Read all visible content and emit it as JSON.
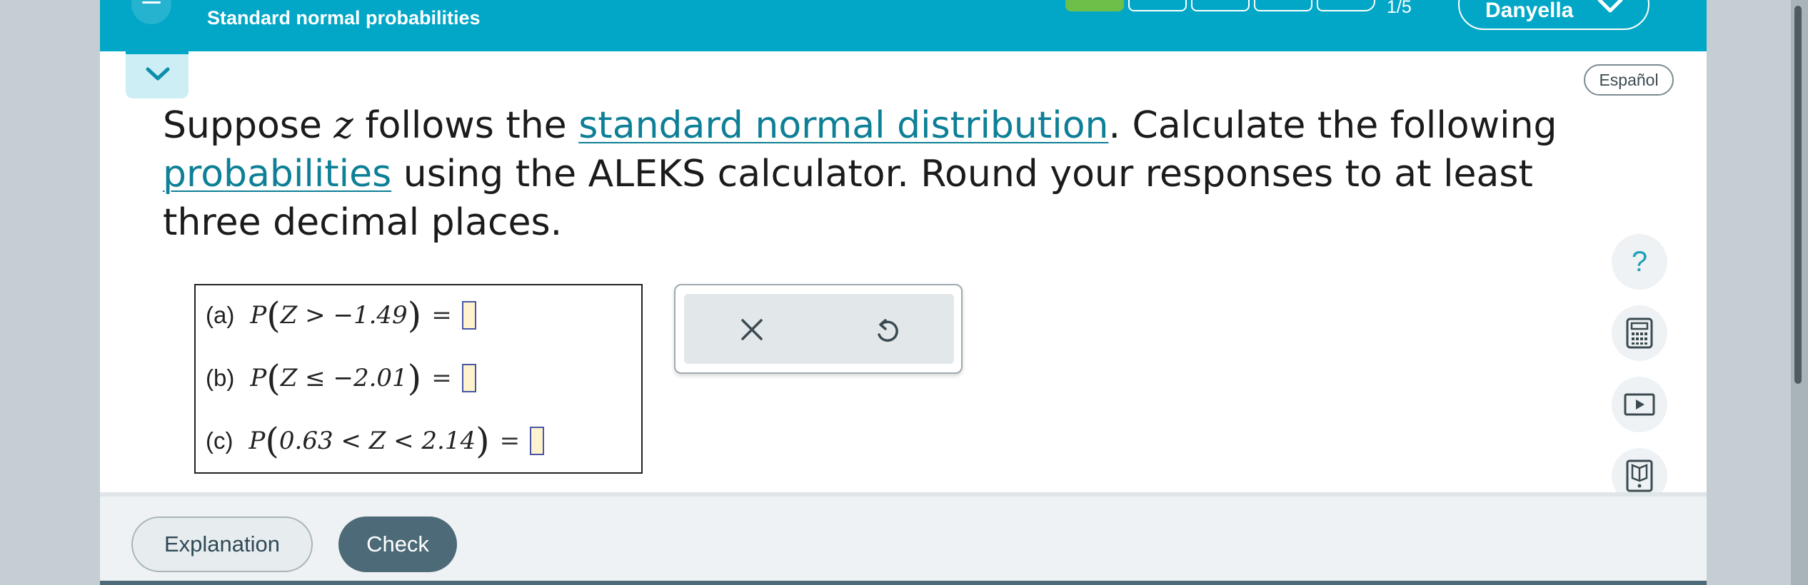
{
  "header": {
    "title": "Standard normal probabilities",
    "progress_text": "1/5",
    "progress_filled_fraction": 0.2,
    "user_name": "Danyella"
  },
  "language_button": "Español",
  "question": {
    "part1": "Suppose ",
    "var": "z",
    "part2": " follows the ",
    "link1": "standard normal distribution",
    "part3": ". Calculate the following ",
    "link2": "probabilities",
    "part4": " using the ALEKS calculator. Round your responses to at least three decimal places."
  },
  "problems": [
    {
      "label": "(a)",
      "inner": "Z > −1.49",
      "value": ""
    },
    {
      "label": "(b)",
      "inner": "Z ≤ −2.01",
      "value": ""
    },
    {
      "label": "(c)",
      "inner": "0.63 < Z < 2.14",
      "value": ""
    }
  ],
  "prob_symbol": "P",
  "equals": "=",
  "side_tools": [
    "help-icon",
    "calculator-icon",
    "video-icon",
    "book-icon"
  ],
  "help_glyph": "?",
  "footer": {
    "explanation_label": "Explanation",
    "check_label": "Check"
  },
  "colors": {
    "brand": "#02a7c7",
    "progress_done": "#6cc04a",
    "link": "#0d7f96",
    "check_button": "#4d6a78"
  }
}
